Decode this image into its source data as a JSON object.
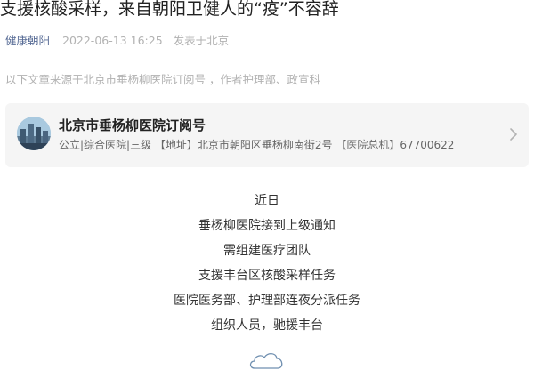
{
  "article": {
    "title": "支援核酸采样，来自朝阳卫健人的“疫”不容辞",
    "account": "健康朝阳",
    "date": "2022-06-13 16:25",
    "location": "发表于北京",
    "source_note": "以下文章来源于北京市垂杨柳医院订阅号 ，作者护理部、政宣科"
  },
  "source_card": {
    "name": "北京市垂杨柳医院订阅号",
    "description": "公立|综合医院|三级 【地址】北京市朝阳区垂杨柳南街2号 【医院总机】67700622",
    "chevron_icon": "chevron-right-icon",
    "avatar_icon": "city-skyline-avatar"
  },
  "body": {
    "lines": [
      "近日",
      "垂杨柳医院接到上级通知",
      "需组建医疗团队",
      "支援丰台区核酸采样任务",
      "医院医务部、护理部连夜分派任务",
      "组织人员，驰援丰台"
    ]
  },
  "decor": {
    "cloud_icon": "cloud-icon"
  },
  "colors": {
    "account_link": "#576b95",
    "meta_gray": "#b2b2b2",
    "card_bg": "#f5f5f5"
  }
}
